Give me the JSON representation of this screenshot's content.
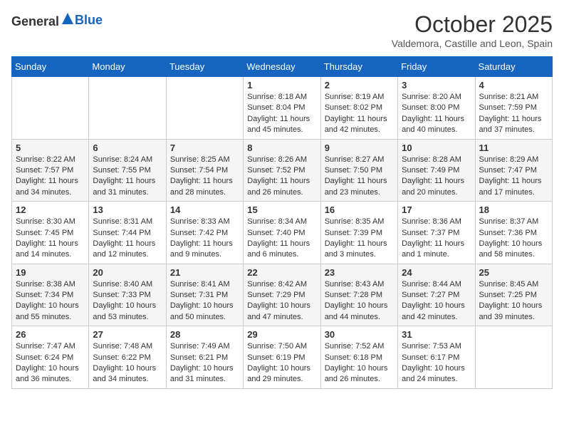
{
  "header": {
    "logo_general": "General",
    "logo_blue": "Blue",
    "month": "October 2025",
    "location": "Valdemora, Castille and Leon, Spain"
  },
  "weekdays": [
    "Sunday",
    "Monday",
    "Tuesday",
    "Wednesday",
    "Thursday",
    "Friday",
    "Saturday"
  ],
  "weeks": [
    [
      {
        "day": "",
        "content": ""
      },
      {
        "day": "",
        "content": ""
      },
      {
        "day": "",
        "content": ""
      },
      {
        "day": "1",
        "content": "Sunrise: 8:18 AM\nSunset: 8:04 PM\nDaylight: 11 hours and 45 minutes."
      },
      {
        "day": "2",
        "content": "Sunrise: 8:19 AM\nSunset: 8:02 PM\nDaylight: 11 hours and 42 minutes."
      },
      {
        "day": "3",
        "content": "Sunrise: 8:20 AM\nSunset: 8:00 PM\nDaylight: 11 hours and 40 minutes."
      },
      {
        "day": "4",
        "content": "Sunrise: 8:21 AM\nSunset: 7:59 PM\nDaylight: 11 hours and 37 minutes."
      }
    ],
    [
      {
        "day": "5",
        "content": "Sunrise: 8:22 AM\nSunset: 7:57 PM\nDaylight: 11 hours and 34 minutes."
      },
      {
        "day": "6",
        "content": "Sunrise: 8:24 AM\nSunset: 7:55 PM\nDaylight: 11 hours and 31 minutes."
      },
      {
        "day": "7",
        "content": "Sunrise: 8:25 AM\nSunset: 7:54 PM\nDaylight: 11 hours and 28 minutes."
      },
      {
        "day": "8",
        "content": "Sunrise: 8:26 AM\nSunset: 7:52 PM\nDaylight: 11 hours and 26 minutes."
      },
      {
        "day": "9",
        "content": "Sunrise: 8:27 AM\nSunset: 7:50 PM\nDaylight: 11 hours and 23 minutes."
      },
      {
        "day": "10",
        "content": "Sunrise: 8:28 AM\nSunset: 7:49 PM\nDaylight: 11 hours and 20 minutes."
      },
      {
        "day": "11",
        "content": "Sunrise: 8:29 AM\nSunset: 7:47 PM\nDaylight: 11 hours and 17 minutes."
      }
    ],
    [
      {
        "day": "12",
        "content": "Sunrise: 8:30 AM\nSunset: 7:45 PM\nDaylight: 11 hours and 14 minutes."
      },
      {
        "day": "13",
        "content": "Sunrise: 8:31 AM\nSunset: 7:44 PM\nDaylight: 11 hours and 12 minutes."
      },
      {
        "day": "14",
        "content": "Sunrise: 8:33 AM\nSunset: 7:42 PM\nDaylight: 11 hours and 9 minutes."
      },
      {
        "day": "15",
        "content": "Sunrise: 8:34 AM\nSunset: 7:40 PM\nDaylight: 11 hours and 6 minutes."
      },
      {
        "day": "16",
        "content": "Sunrise: 8:35 AM\nSunset: 7:39 PM\nDaylight: 11 hours and 3 minutes."
      },
      {
        "day": "17",
        "content": "Sunrise: 8:36 AM\nSunset: 7:37 PM\nDaylight: 11 hours and 1 minute."
      },
      {
        "day": "18",
        "content": "Sunrise: 8:37 AM\nSunset: 7:36 PM\nDaylight: 10 hours and 58 minutes."
      }
    ],
    [
      {
        "day": "19",
        "content": "Sunrise: 8:38 AM\nSunset: 7:34 PM\nDaylight: 10 hours and 55 minutes."
      },
      {
        "day": "20",
        "content": "Sunrise: 8:40 AM\nSunset: 7:33 PM\nDaylight: 10 hours and 53 minutes."
      },
      {
        "day": "21",
        "content": "Sunrise: 8:41 AM\nSunset: 7:31 PM\nDaylight: 10 hours and 50 minutes."
      },
      {
        "day": "22",
        "content": "Sunrise: 8:42 AM\nSunset: 7:29 PM\nDaylight: 10 hours and 47 minutes."
      },
      {
        "day": "23",
        "content": "Sunrise: 8:43 AM\nSunset: 7:28 PM\nDaylight: 10 hours and 44 minutes."
      },
      {
        "day": "24",
        "content": "Sunrise: 8:44 AM\nSunset: 7:27 PM\nDaylight: 10 hours and 42 minutes."
      },
      {
        "day": "25",
        "content": "Sunrise: 8:45 AM\nSunset: 7:25 PM\nDaylight: 10 hours and 39 minutes."
      }
    ],
    [
      {
        "day": "26",
        "content": "Sunrise: 7:47 AM\nSunset: 6:24 PM\nDaylight: 10 hours and 36 minutes."
      },
      {
        "day": "27",
        "content": "Sunrise: 7:48 AM\nSunset: 6:22 PM\nDaylight: 10 hours and 34 minutes."
      },
      {
        "day": "28",
        "content": "Sunrise: 7:49 AM\nSunset: 6:21 PM\nDaylight: 10 hours and 31 minutes."
      },
      {
        "day": "29",
        "content": "Sunrise: 7:50 AM\nSunset: 6:19 PM\nDaylight: 10 hours and 29 minutes."
      },
      {
        "day": "30",
        "content": "Sunrise: 7:52 AM\nSunset: 6:18 PM\nDaylight: 10 hours and 26 minutes."
      },
      {
        "day": "31",
        "content": "Sunrise: 7:53 AM\nSunset: 6:17 PM\nDaylight: 10 hours and 24 minutes."
      },
      {
        "day": "",
        "content": ""
      }
    ]
  ]
}
